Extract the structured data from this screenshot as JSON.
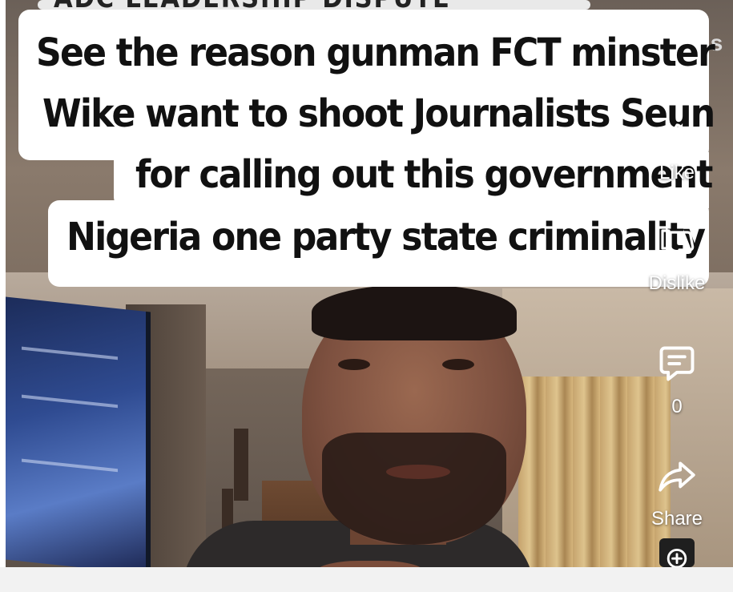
{
  "top_overlay": {
    "peek_text": "ADC LEADERSHIP DISPUTE",
    "right_peek": "is"
  },
  "caption": {
    "lines": [
      "See the reason gunman FCT minster",
      "Wike want to shoot Journalists Seun",
      "for calling out this government",
      "Nigeria one party state  criminality"
    ]
  },
  "actions": {
    "like": {
      "label": "Like",
      "icon": "thumbs-up-icon"
    },
    "dislike": {
      "label": "Dislike",
      "icon": "thumbs-down-icon"
    },
    "comments": {
      "count": "0",
      "icon": "comment-icon"
    },
    "share": {
      "label": "Share",
      "icon": "share-icon"
    },
    "remix": {
      "icon": "remix-icon"
    }
  },
  "colors": {
    "caption_bg": "#ffffff",
    "caption_text": "#111111",
    "rail_text": "#ffffff"
  }
}
